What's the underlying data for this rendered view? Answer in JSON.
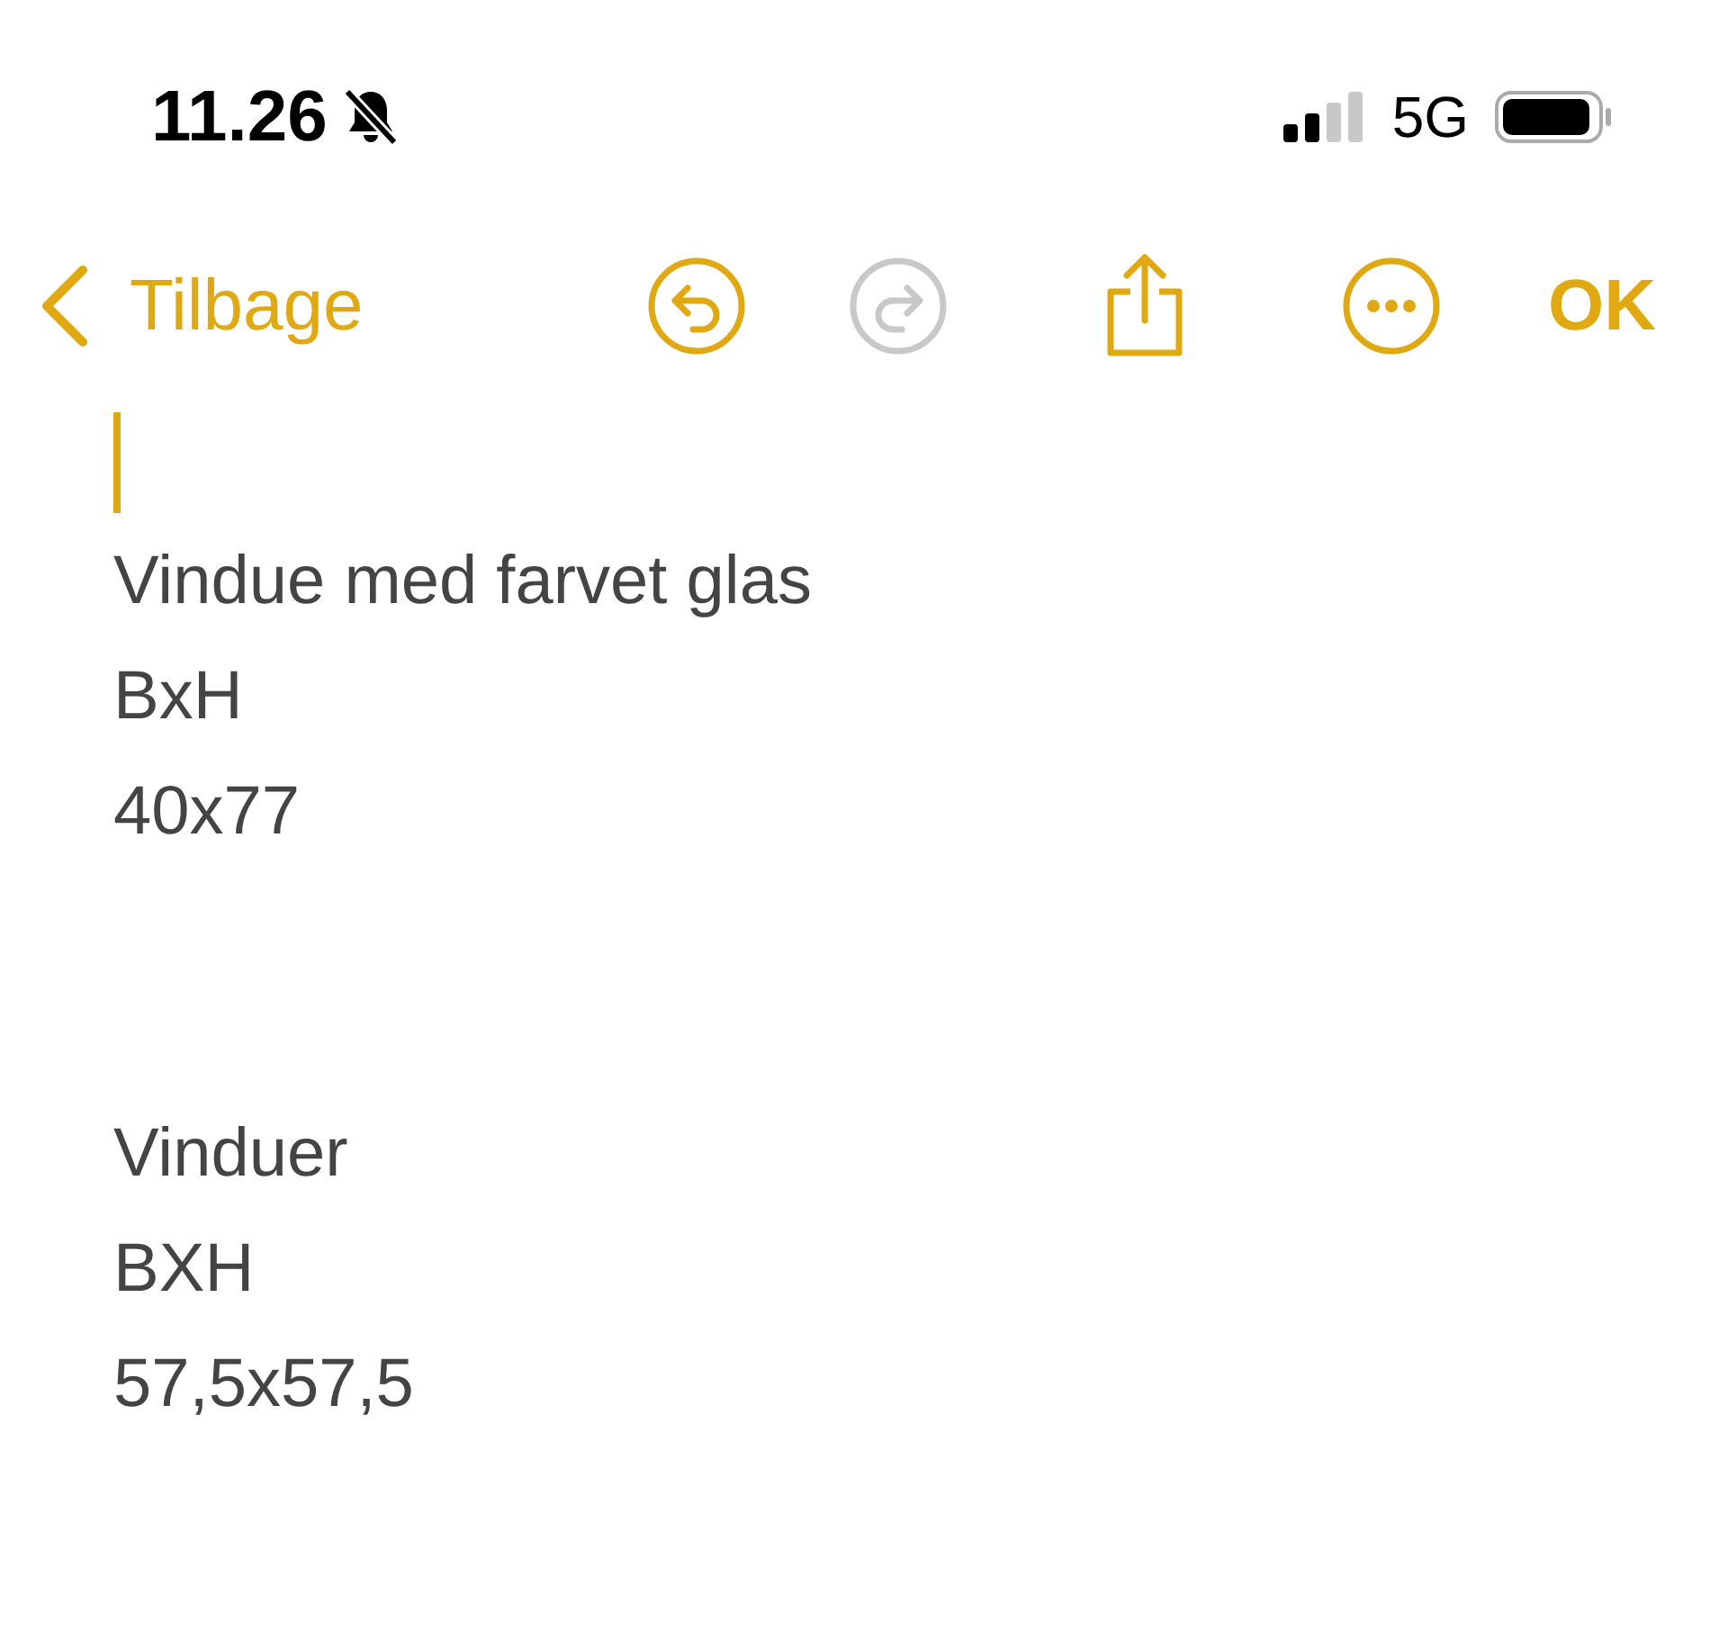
{
  "status_bar": {
    "time": "11.26",
    "silent": true,
    "network": "5G"
  },
  "toolbar": {
    "back": "Tilbage",
    "undo_disabled": false,
    "redo_disabled": true,
    "done": "OK"
  },
  "note": {
    "cursor": true,
    "blocks": [
      {
        "lines": [
          "Vindue med farvet glas",
          "BxH",
          "40x77"
        ]
      },
      {
        "lines": [
          "Vinduer",
          "BXH",
          "57,5x57,5"
        ]
      }
    ]
  }
}
